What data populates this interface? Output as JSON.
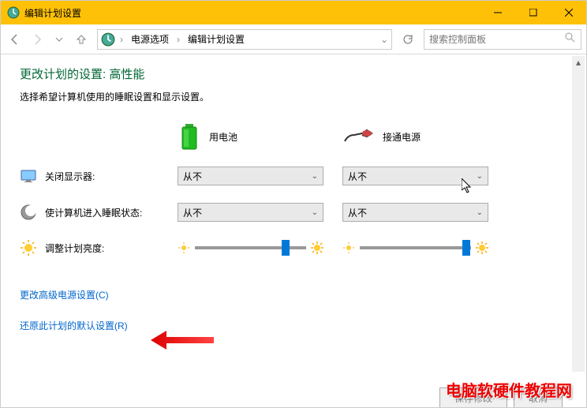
{
  "titlebar": {
    "title": "编辑计划设置"
  },
  "breadcrumb": {
    "item1": "电源选项",
    "item2": "编辑计划设置"
  },
  "search": {
    "placeholder": "搜索控制面板"
  },
  "page": {
    "heading": "更改计划的设置: 高性能",
    "subtitle": "选择希望计算机使用的睡眠设置和显示设置。"
  },
  "columns": {
    "battery": "用电池",
    "plugged": "接通电源"
  },
  "rows": {
    "display_off": {
      "label": "关闭显示器:",
      "battery": "从不",
      "plugged": "从不"
    },
    "sleep": {
      "label": "使计算机进入睡眠状态:",
      "battery": "从不",
      "plugged": "从不"
    },
    "brightness": {
      "label": "调整计划亮度:"
    }
  },
  "links": {
    "advanced": "更改高级电源设置(C)",
    "restore": "还原此计划的默认设置(R)"
  },
  "footer": {
    "save": "保存修改",
    "cancel": "取消"
  },
  "watermark": "电脑软硬件教程网"
}
